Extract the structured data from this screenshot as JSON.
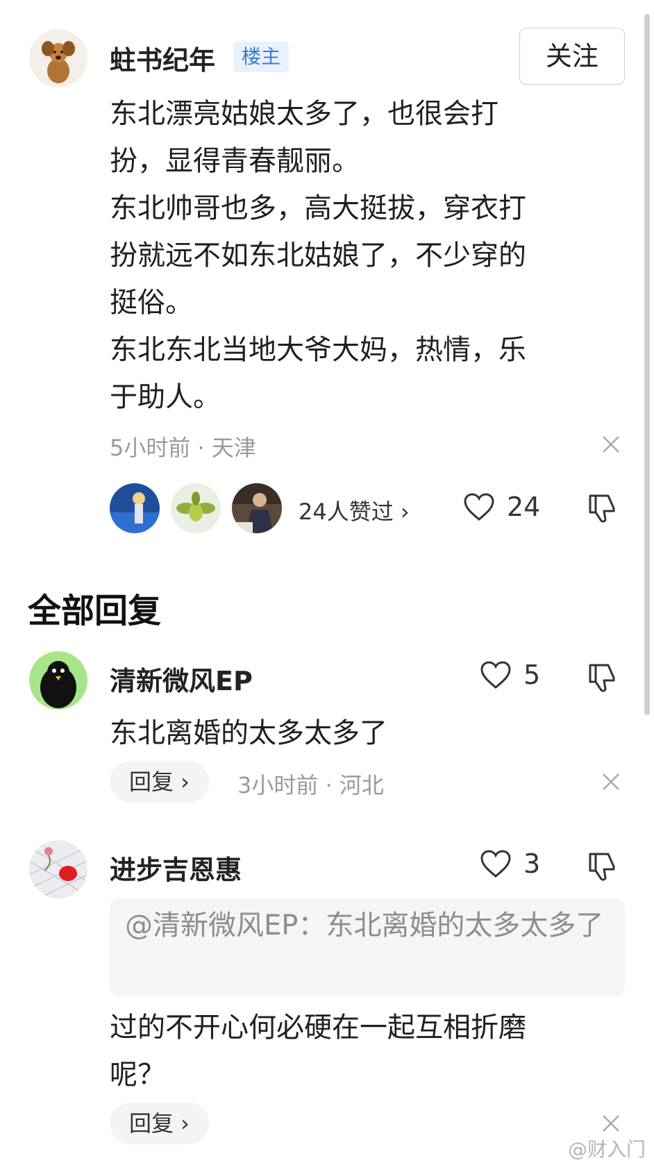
{
  "post": {
    "author": "蛀书纪年",
    "badge": "楼主",
    "follow_label": "关注",
    "lines": [
      "东北漂亮姑娘太多了，也很会打",
      "扮，显得青春靓丽。",
      "东北帅哥也多，高大挺拔，穿衣打",
      "扮就远不如东北姑娘了，不少穿的",
      "挺俗。",
      "东北东北当地大爷大妈，热情，乐",
      "于助人。"
    ],
    "meta": "5小时前 · 天津",
    "likers_text": "24人赞过 ›",
    "like_count": "24"
  },
  "section_title": "全部回复",
  "replies": [
    {
      "author": "清新微风EP",
      "text": "东北离婚的太多太多了",
      "like_count": "5",
      "reply_label": "回复 ›",
      "meta": "3小时前 · 河北"
    },
    {
      "author": "进步吉恩惠",
      "quote": "@清新微风EP：东北离婚的太多太多了",
      "text_lines": [
        "过的不开心何必硬在一起互相折磨",
        "呢？"
      ],
      "like_count": "3",
      "reply_label": "回复 ›"
    }
  ],
  "watermark": "@财入门",
  "colors": {
    "badge_bg": "#e8f1fd",
    "badge_text": "#3a7bd5",
    "meta_gray": "#9a9a9a"
  }
}
